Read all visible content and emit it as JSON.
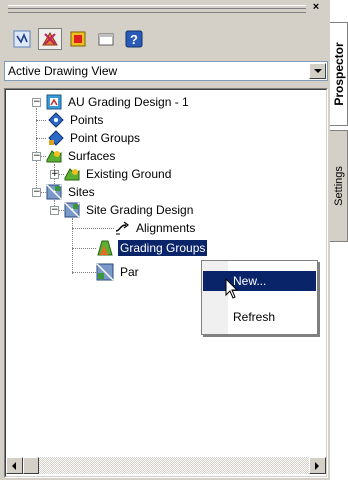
{
  "panel": {
    "close_glyph": "×",
    "toolbar": [
      {
        "icon": "prospector-view-icon"
      },
      {
        "icon": "settings-view-icon"
      },
      {
        "icon": "survey-icon"
      },
      {
        "icon": "toolspace-icon"
      },
      {
        "icon": "help-icon"
      }
    ],
    "view_select": {
      "value": "Active Drawing View"
    }
  },
  "tree": {
    "root": {
      "label": "AU Grading Design - 1",
      "expander": "−"
    },
    "points": {
      "label": "Points"
    },
    "point_groups": {
      "label": "Point Groups"
    },
    "surfaces": {
      "label": "Surfaces",
      "expander": "−"
    },
    "existing_ground": {
      "label": "Existing Ground",
      "expander": "+"
    },
    "sites": {
      "label": "Sites",
      "expander": "−"
    },
    "site_grading_design": {
      "label": "Site Grading Design",
      "expander": "−"
    },
    "alignments": {
      "label": "Alignments"
    },
    "grading_groups": {
      "label": "Grading Groups",
      "selected": true
    },
    "parcels": {
      "label": "Par"
    }
  },
  "context_menu": {
    "items": [
      {
        "label": "New...",
        "highlighted": true
      },
      {
        "label": "Refresh",
        "highlighted": false
      }
    ]
  },
  "side_tabs": {
    "prospector": "Prospector",
    "settings": "Settings"
  },
  "colors": {
    "selection": "#0a246a",
    "panel_bg": "#d4d0c8"
  }
}
